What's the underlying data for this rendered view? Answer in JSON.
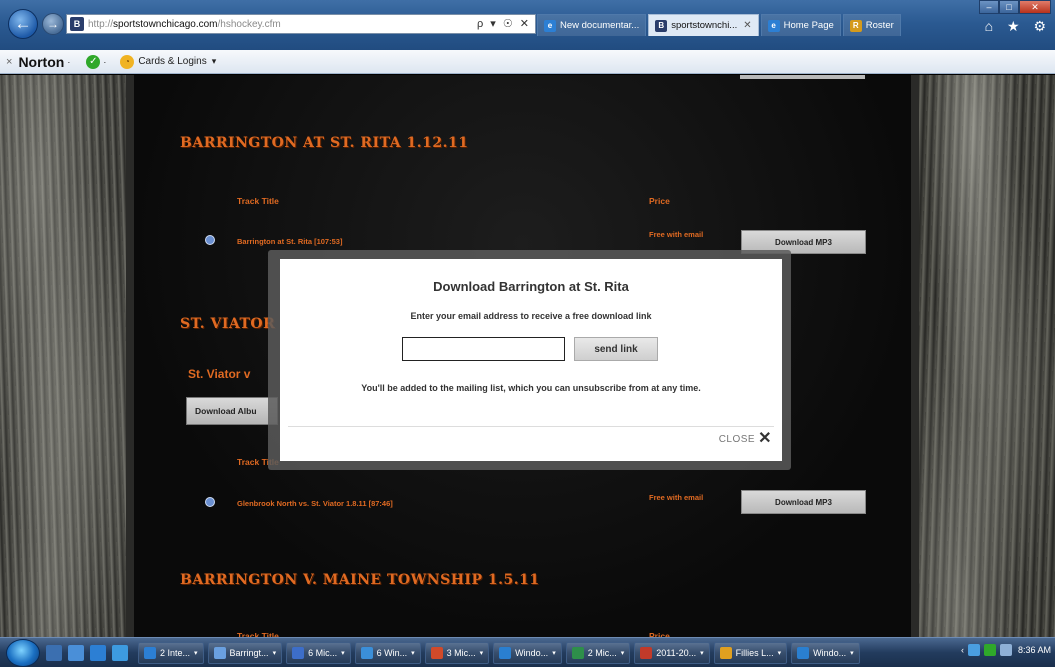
{
  "browser": {
    "address": {
      "protocol": "http://",
      "host": "sportstownchicago.com",
      "path": "/hshockey.cfm",
      "tools": "ρ ▾ ☉ ✕"
    },
    "tabs": [
      {
        "label": "New documentar...",
        "active": false,
        "icon_color": "#2c7fd4"
      },
      {
        "label": "sportstownchi...",
        "active": true,
        "icon_color": "#2a3d6b"
      },
      {
        "label": "Home Page",
        "active": false,
        "icon_color": "#2c7fd4"
      },
      {
        "label": "Roster",
        "active": false,
        "icon_color": "#d49a1c"
      }
    ],
    "window_controls": {
      "minimize": "–",
      "maximize": "□",
      "close": "✕"
    },
    "right_tools": "⌂ ★ ⚙"
  },
  "toolbar": {
    "close_glyph": "×",
    "norton_label": "Norton",
    "norton_caret": "·",
    "check_caret": "·",
    "cards_label": "Cards & Logins",
    "cards_caret": "▾"
  },
  "page": {
    "sections": [
      {
        "heading": "BARRINGTON AT ST. RITA 1.12.11"
      },
      {
        "heading": "ST. VIATOR V"
      },
      {
        "heading": "BARRINGTON V. MAINE TOWNSHIP 1.5.11"
      }
    ],
    "column_headers": {
      "track_title": "Track Title",
      "price": "Price"
    },
    "tracks": [
      {
        "title": "Barrington at St. Rita [107:53]",
        "price": "Free with email",
        "button": "Download MP3"
      },
      {
        "title": "Glenbrook North vs. St. Viator 1.8.11 [87:46]",
        "price": "Free with email",
        "button": "Download MP3"
      }
    ],
    "album": {
      "label": "St. Viator v",
      "button": "Download Albu"
    }
  },
  "modal": {
    "title": "Download Barrington at St. Rita",
    "subtitle": "Enter your email address to receive a free download link",
    "email_value": "",
    "send_label": "send link",
    "note": "You'll be added to the mailing list, which you can unsubscribe from at any time.",
    "close_label": "CLOSE",
    "close_glyph": "✕"
  },
  "taskbar": {
    "buttons": [
      {
        "label": "2 Inte...",
        "icon_color": "#2c7fd4"
      },
      {
        "label": "Barringt...",
        "icon_color": "#6aa0e0"
      },
      {
        "label": "6 Mic...",
        "icon_color": "#3d6ec9"
      },
      {
        "label": "6 Win...",
        "icon_color": "#3b8fd9"
      },
      {
        "label": "3 Mic...",
        "icon_color": "#d04a2a"
      },
      {
        "label": "Windo...",
        "icon_color": "#2a7fd0"
      },
      {
        "label": "2 Mic...",
        "icon_color": "#2e8f4a"
      },
      {
        "label": "2011-20...",
        "icon_color": "#c23a2a"
      },
      {
        "label": "Fillies L...",
        "icon_color": "#e0a020"
      },
      {
        "label": "Windo...",
        "icon_color": "#2a7fd0"
      }
    ],
    "caret": "▾",
    "clock": "8:36 AM",
    "tray_arrow": "‹"
  },
  "colors": {
    "accent_orange": "#e06a22",
    "modal_bg": "#ffffff"
  }
}
